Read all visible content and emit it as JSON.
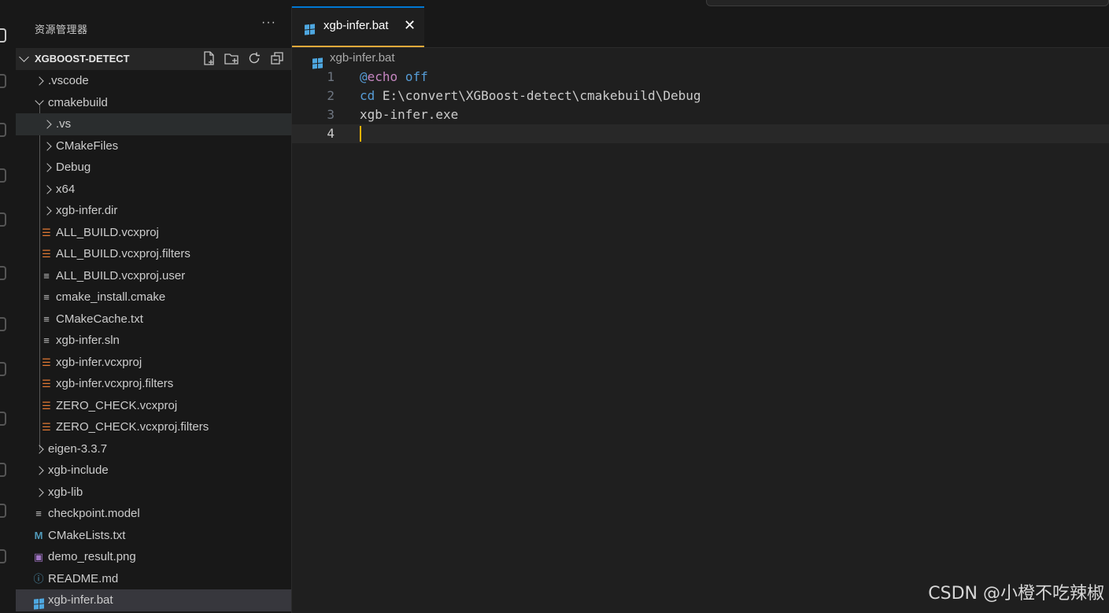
{
  "sidebar": {
    "title": "资源管理器",
    "more_label": "···",
    "section_title": "XGBOOST-DETECT",
    "actions": [
      "new-file",
      "new-folder",
      "refresh",
      "collapse-all"
    ],
    "items": [
      {
        "label": ".vscode",
        "type": "folder",
        "expanded": false,
        "depth": 0
      },
      {
        "label": "cmakebuild",
        "type": "folder",
        "expanded": true,
        "depth": 0
      },
      {
        "label": ".vs",
        "type": "folder",
        "expanded": false,
        "depth": 1
      },
      {
        "label": "CMakeFiles",
        "type": "folder",
        "expanded": false,
        "depth": 1
      },
      {
        "label": "Debug",
        "type": "folder",
        "expanded": false,
        "depth": 1
      },
      {
        "label": "x64",
        "type": "folder",
        "expanded": false,
        "depth": 1
      },
      {
        "label": "xgb-infer.dir",
        "type": "folder",
        "expanded": false,
        "depth": 1
      },
      {
        "label": "ALL_BUILD.vcxproj",
        "type": "file",
        "icon": "rss-icon",
        "depth": 1
      },
      {
        "label": "ALL_BUILD.vcxproj.filters",
        "type": "file",
        "icon": "rss-icon",
        "depth": 1
      },
      {
        "label": "ALL_BUILD.vcxproj.user",
        "type": "file",
        "icon": "lines-icon",
        "depth": 1
      },
      {
        "label": "cmake_install.cmake",
        "type": "file",
        "icon": "lines-icon",
        "depth": 1
      },
      {
        "label": "CMakeCache.txt",
        "type": "file",
        "icon": "lines-icon",
        "depth": 1
      },
      {
        "label": "xgb-infer.sln",
        "type": "file",
        "icon": "lines-icon",
        "depth": 1
      },
      {
        "label": "xgb-infer.vcxproj",
        "type": "file",
        "icon": "rss-icon",
        "depth": 1
      },
      {
        "label": "xgb-infer.vcxproj.filters",
        "type": "file",
        "icon": "rss-icon",
        "depth": 1
      },
      {
        "label": "ZERO_CHECK.vcxproj",
        "type": "file",
        "icon": "rss-icon",
        "depth": 1
      },
      {
        "label": "ZERO_CHECK.vcxproj.filters",
        "type": "file",
        "icon": "rss-icon",
        "depth": 1
      },
      {
        "label": "eigen-3.3.7",
        "type": "folder",
        "expanded": false,
        "depth": 0
      },
      {
        "label": "xgb-include",
        "type": "folder",
        "expanded": false,
        "depth": 0
      },
      {
        "label": "xgb-lib",
        "type": "folder",
        "expanded": false,
        "depth": 0
      },
      {
        "label": "checkpoint.model",
        "type": "file",
        "icon": "lines-icon",
        "depth": 0
      },
      {
        "label": "CMakeLists.txt",
        "type": "file",
        "icon": "cmake-m-icon",
        "depth": 0
      },
      {
        "label": "demo_result.png",
        "type": "file",
        "icon": "image-icon",
        "depth": 0
      },
      {
        "label": "README.md",
        "type": "file",
        "icon": "info-icon",
        "depth": 0
      },
      {
        "label": "xgb-infer.bat",
        "type": "file",
        "icon": "windows-icon",
        "depth": 0
      }
    ]
  },
  "editor": {
    "tab_label": "xgb-infer.bat",
    "close_glyph": "✕",
    "breadcrumb": "xgb-infer.bat",
    "lines": [
      {
        "num": "1",
        "text": "@echo off"
      },
      {
        "num": "2",
        "text": "cd E:\\convert\\XGBoost-detect\\cmakebuild\\Debug"
      },
      {
        "num": "3",
        "text": "xgb-infer.exe"
      },
      {
        "num": "4",
        "text": ""
      }
    ]
  },
  "watermark": "CSDN @小橙不吃辣椒",
  "colors": {
    "accent": "#0078d4",
    "cursor": "#ffb300",
    "rss_icon": "#e37933",
    "windows_icon": "#4ea7e0"
  }
}
